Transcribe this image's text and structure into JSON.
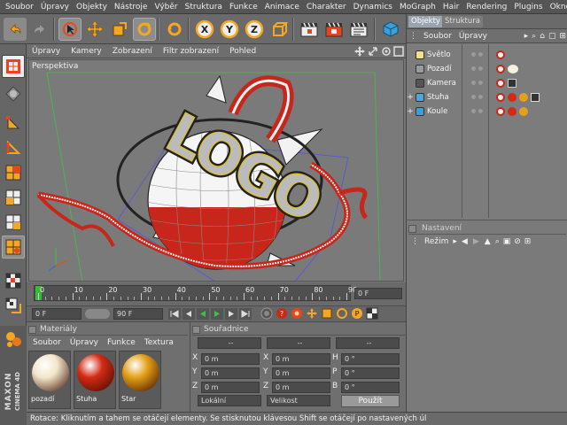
{
  "menu": [
    "Soubor",
    "Úpravy",
    "Objekty",
    "Nástroje",
    "Výběr",
    "Struktura",
    "Funkce",
    "Animace",
    "Charakter",
    "Dynamics",
    "MoGraph",
    "Hair",
    "Rendering",
    "Plugins",
    "Okno"
  ],
  "viewport": {
    "menu": [
      "Úpravy",
      "Kamery",
      "Zobrazení",
      "Filtr zobrazení",
      "Pohled"
    ],
    "label": "Perspektiva",
    "logo_text": "LOGO"
  },
  "toolbar": {
    "axis_x": "X",
    "axis_y": "Y",
    "axis_z": "Z"
  },
  "timeline": {
    "ticks": [
      "0",
      "10",
      "20",
      "30",
      "40",
      "50",
      "60",
      "70",
      "80",
      "90"
    ],
    "current_frame": "0 F"
  },
  "transport": {
    "start": "0 F",
    "end": "90 F"
  },
  "objects": {
    "tabs": [
      "Objekty",
      "Struktura"
    ],
    "menu": [
      "Soubor",
      "Úpravy"
    ],
    "items": [
      {
        "name": "Světlo",
        "indent": 0
      },
      {
        "name": "Pozadí",
        "indent": 0
      },
      {
        "name": "Kamera",
        "indent": 0
      },
      {
        "name": "Stuha",
        "indent": 0
      },
      {
        "name": "Koule",
        "indent": 0
      }
    ]
  },
  "attributes": {
    "title": "Nastavení",
    "mode": "Režim"
  },
  "materials": {
    "title": "Materiály",
    "menu": [
      "Soubor",
      "Úpravy",
      "Funkce",
      "Textura"
    ],
    "items": [
      {
        "name": "pozadí",
        "color": "#f3e6c9"
      },
      {
        "name": "Stuha",
        "color": "#d42a14"
      },
      {
        "name": "Star",
        "color": "#e4a018"
      }
    ]
  },
  "coordinates": {
    "title": "Souřadnice",
    "header_pos": "--",
    "header_size": "--",
    "header_rot": "--",
    "pos_labels": [
      "X",
      "Y",
      "Z"
    ],
    "size_labels": [
      "X",
      "Y",
      "Z"
    ],
    "rot_labels": [
      "H",
      "P",
      "B"
    ],
    "pos_values": [
      "0 m",
      "0 m",
      "0 m"
    ],
    "size_values": [
      "0 m",
      "0 m",
      "0 m"
    ],
    "rot_values": [
      "0 °",
      "0 °",
      "0 °"
    ],
    "mode1": "Lokální",
    "mode2": "Velikost",
    "apply": "Použít"
  },
  "brand": {
    "line1": "MAXON",
    "line2": "CINEMA 4D"
  },
  "status": "Rotace: Kliknutím a tahem se otáčejí elementy. Se stisknutou klávesou Shift se otáčejí po nastavených úl",
  "colors": {
    "panel": "#767676",
    "dark": "#4b4b4b",
    "accent_red": "#c8261a",
    "tab_active": "#9aa4b0"
  }
}
